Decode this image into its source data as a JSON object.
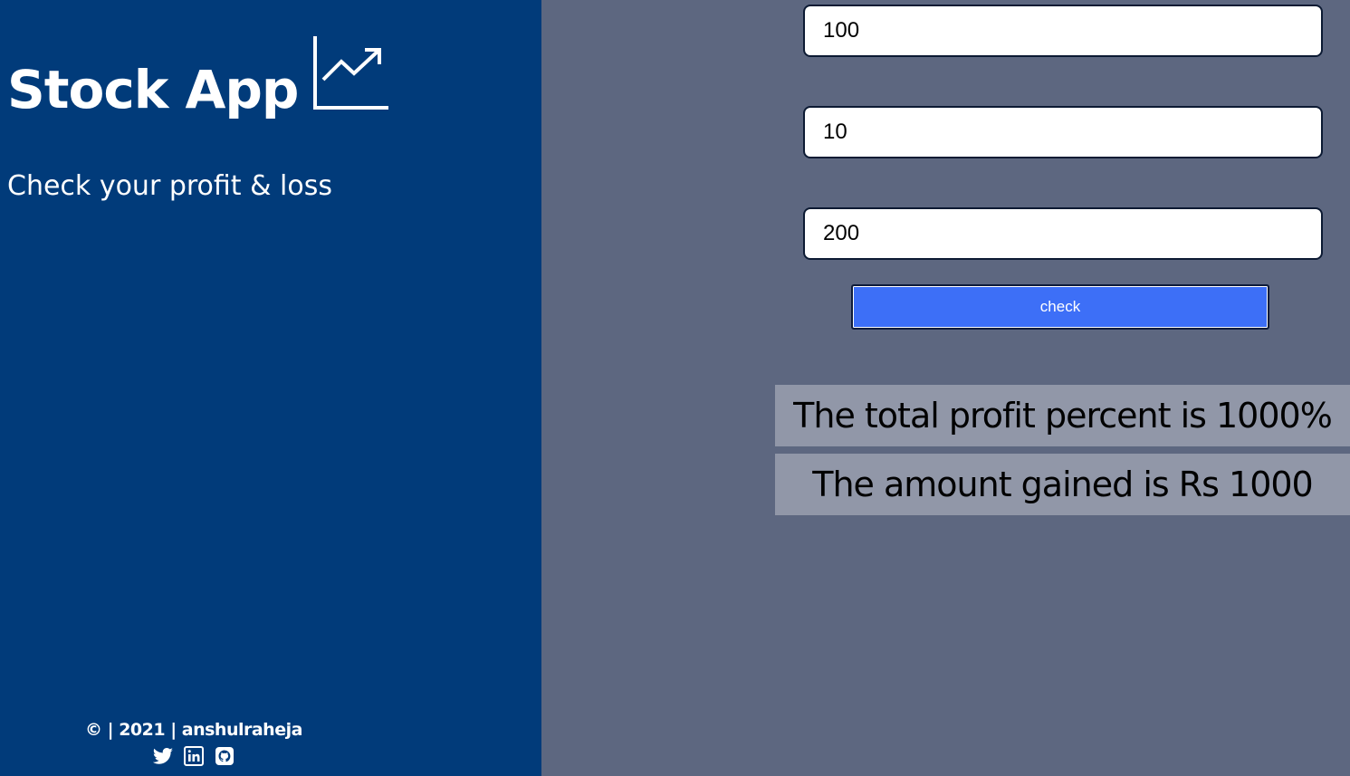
{
  "app": {
    "title": "Stock App",
    "tagline": "Check your profit & loss",
    "brand_icon": "trending-up-chart-icon"
  },
  "form": {
    "initial_price": "100",
    "quantity": "10",
    "current_price": "200",
    "check_label": "check"
  },
  "results": {
    "profit_percent_text": "The total profit percent is 1000%",
    "amount_text": "The amount gained is Rs 1000"
  },
  "footer": {
    "copyright": "© | 2021 | anshulraheja",
    "social_icons": [
      "twitter-icon",
      "linkedin-icon",
      "github-icon"
    ]
  },
  "colors": {
    "sidebar_bg": "#013b7a",
    "main_bg": "#5d6780",
    "button_bg": "#3d6ff7",
    "result_bg": "#9197a8"
  }
}
